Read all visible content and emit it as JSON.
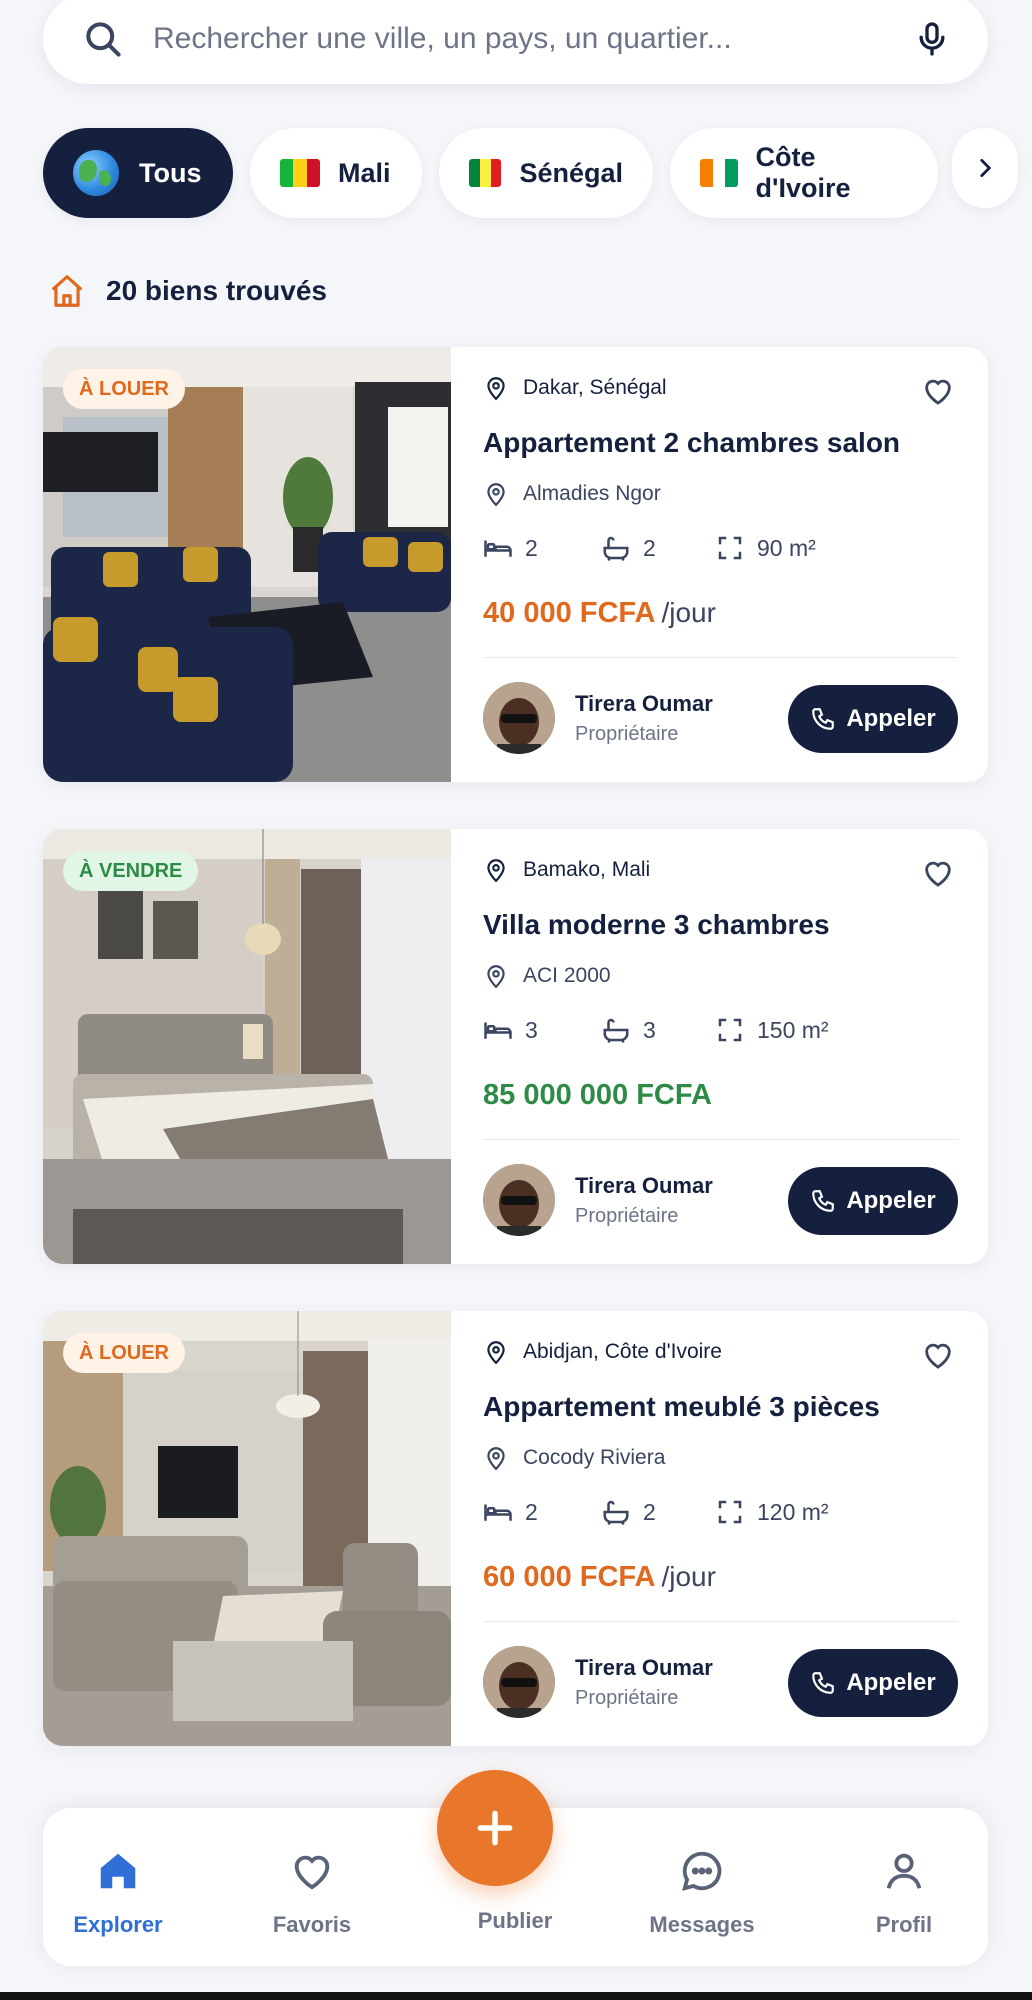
{
  "search": {
    "placeholder": "Rechercher une ville, un pays, un quartier..."
  },
  "filters": [
    {
      "label": "Tous",
      "active": true,
      "icon": "globe-icon"
    },
    {
      "label": "Mali",
      "active": false,
      "flag": [
        "#14b53a",
        "#fcd116",
        "#ce1126"
      ]
    },
    {
      "label": "Sénégal",
      "active": false,
      "flag": [
        "#00853f",
        "#fdef42",
        "#e31b23"
      ]
    },
    {
      "label": "Côte d'Ivoire",
      "active": false,
      "flag": [
        "#f77f00",
        "#ffffff",
        "#009e60"
      ]
    }
  ],
  "results": {
    "count_label": "20 biens trouvés"
  },
  "listings": [
    {
      "badge": "À LOUER",
      "badge_type": "rent",
      "location": "Dakar, Sénégal",
      "title": "Appartement 2 chambres salon",
      "area": "Almadies Ngor",
      "beds": "2",
      "baths": "2",
      "surface": "90 m²",
      "price": "40 000 FCFA",
      "price_unit": "/jour",
      "owner_name": "Tirera Oumar",
      "owner_role": "Propriétaire",
      "call_label": "Appeler"
    },
    {
      "badge": "À VENDRE",
      "badge_type": "sale",
      "location": "Bamako, Mali",
      "title": "Villa moderne 3 chambres",
      "area": "ACI 2000",
      "beds": "3",
      "baths": "3",
      "surface": "150 m²",
      "price": "85 000 000 FCFA",
      "price_unit": "",
      "owner_name": "Tirera Oumar",
      "owner_role": "Propriétaire",
      "call_label": "Appeler"
    },
    {
      "badge": "À LOUER",
      "badge_type": "rent",
      "location": "Abidjan, Côte d'Ivoire",
      "title": "Appartement meublé 3 pièces",
      "area": "Cocody Riviera",
      "beds": "2",
      "baths": "2",
      "surface": "120 m²",
      "price": "60 000 FCFA",
      "price_unit": "/jour",
      "owner_name": "Tirera Oumar",
      "owner_role": "Propriétaire",
      "call_label": "Appeler"
    }
  ],
  "nav": {
    "explorer": "Explorer",
    "favoris": "Favoris",
    "publier": "Publier",
    "messages": "Messages",
    "profil": "Profil"
  },
  "colors": {
    "navy": "#14203d",
    "orange": "#e0691e",
    "green": "#2e8b46",
    "blue": "#2f6fd6"
  }
}
